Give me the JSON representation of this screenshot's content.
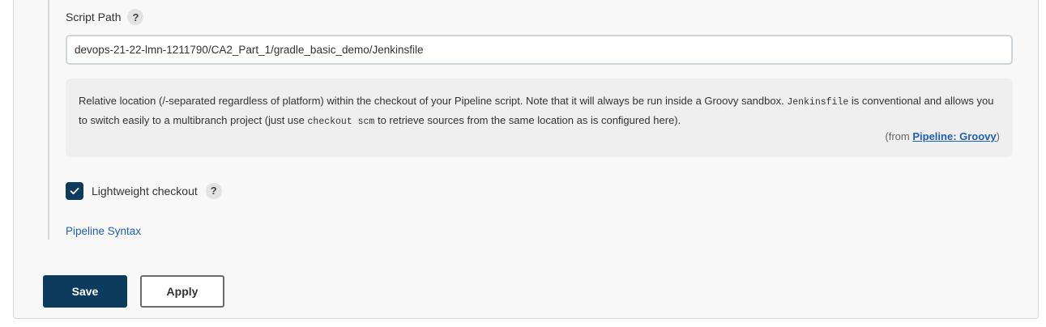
{
  "script_path": {
    "label": "Script Path",
    "help_icon": "question-mark-icon",
    "help_symbol": "?",
    "value": "devops-21-22-lmn-1211790/CA2_Part_1/gradle_basic_demo/Jenkinsfile"
  },
  "help_text": {
    "part1": "Relative location (/-separated regardless of platform) within the checkout of your Pipeline script. Note that it will always be run inside a Groovy sandbox. ",
    "code1": "Jenkinsfile",
    "part2": " is conventional and allows you to switch easily to a multibranch project (just use ",
    "code2": "checkout scm",
    "part3": " to retrieve sources from the same location as is configured here).",
    "from_prefix": "(from ",
    "from_link": "Pipeline: Groovy",
    "from_suffix": ")"
  },
  "lightweight_checkout": {
    "label": "Lightweight checkout",
    "checked": true,
    "help_symbol": "?"
  },
  "pipeline_syntax_link": "Pipeline Syntax",
  "buttons": {
    "save": "Save",
    "apply": "Apply"
  },
  "colors": {
    "primary": "#0d3b5e",
    "link": "#1f5fb4",
    "panel_bg": "#f8f8f8",
    "help_bg": "#efefef"
  }
}
